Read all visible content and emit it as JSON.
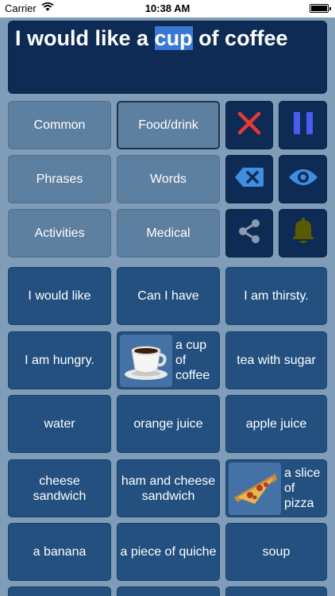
{
  "status_bar": {
    "carrier": "Carrier",
    "time": "10:38 AM"
  },
  "sentence": {
    "before": "I would like a ",
    "highlight": "cup",
    "after": " of coffee"
  },
  "categories": [
    "Common",
    "Food/drink",
    "Phrases",
    "Words",
    "Activities",
    "Medical"
  ],
  "active_category": "Food/drink",
  "controls": {
    "clear": "close-icon",
    "pause": "pause-icon",
    "backspace": "backspace-icon",
    "view": "eye-icon",
    "share": "share-icon",
    "alert": "bell-icon"
  },
  "phrases": [
    "I would like",
    "Can I have",
    "I am thirsty.",
    "I am hungry.",
    "a cup of coffee",
    "tea with sugar",
    "water",
    "orange juice",
    "apple juice",
    "cheese sandwich",
    "ham and cheese sandwich",
    "a slice of pizza",
    "a banana",
    "a piece of quiche",
    "soup"
  ],
  "colors": {
    "background": "#7f9db8",
    "sentence_bg": "#0d2b55",
    "highlight": "#3a78d6",
    "clear_x": "#e53935",
    "pause": "#4a5cf0",
    "bell": "#5a5a00"
  }
}
